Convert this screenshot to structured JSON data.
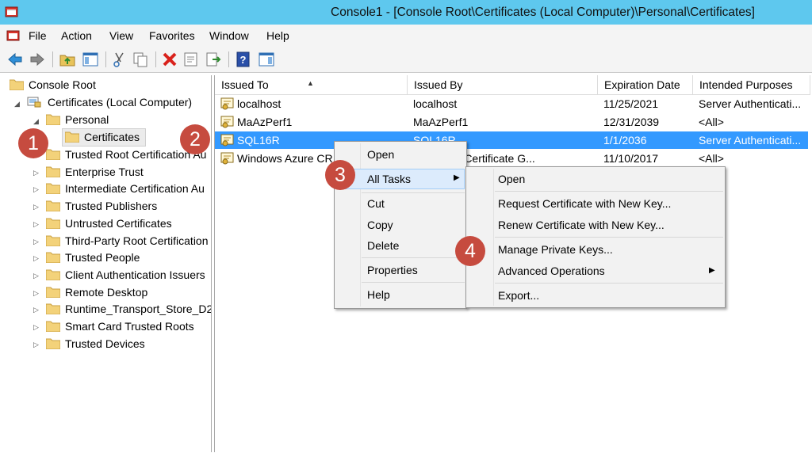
{
  "window": {
    "title": "Console1 - [Console Root\\Certificates (Local Computer)\\Personal\\Certificates]"
  },
  "menubar": {
    "items": [
      "File",
      "Action",
      "View",
      "Favorites",
      "Window",
      "Help"
    ]
  },
  "toolbar": {
    "buttons": [
      "back-arrow-icon",
      "forward-arrow-icon",
      "up-folder-icon",
      "show-hide-tree-icon",
      "cut-icon",
      "copy-icon",
      "delete-icon",
      "properties-icon",
      "export-list-icon",
      "help-icon",
      "show-action-pane-icon"
    ]
  },
  "tree": {
    "root": "Console Root",
    "computer": "Certificates (Local Computer)",
    "personal": "Personal",
    "certificates": "Certificates",
    "items": [
      "Trusted Root Certification Au",
      "Enterprise Trust",
      "Intermediate Certification Au",
      "Trusted Publishers",
      "Untrusted Certificates",
      "Third-Party Root Certification",
      "Trusted People",
      "Client Authentication Issuers",
      "Remote Desktop",
      "Runtime_Transport_Store_D2",
      "Smart Card Trusted Roots",
      "Trusted Devices"
    ]
  },
  "list": {
    "columns": [
      "Issued To",
      "Issued By",
      "Expiration Date",
      "Intended Purposes"
    ],
    "rows": [
      [
        "localhost",
        "localhost",
        "11/25/2021",
        "Server Authenticati..."
      ],
      [
        "MaAzPerf1",
        "MaAzPerf1",
        "12/31/2039",
        "<All>"
      ],
      [
        "SQL16R",
        "SQL16R",
        "1/1/2036",
        "Server Authenticati..."
      ],
      [
        "Windows Azure CR",
        "zure CRP Certificate G...",
        "11/10/2017",
        "<All>"
      ]
    ],
    "selected_row": 2
  },
  "context_menu": {
    "open": "Open",
    "all_tasks": "All Tasks",
    "cut": "Cut",
    "copy": "Copy",
    "delete": "Delete",
    "properties": "Properties",
    "help": "Help"
  },
  "submenu": {
    "open": "Open",
    "request": "Request Certificate with New Key...",
    "renew": "Renew Certificate with New Key...",
    "manage_keys": "Manage Private Keys...",
    "advanced": "Advanced Operations",
    "export": "Export..."
  },
  "badges": [
    "1",
    "2",
    "3",
    "4"
  ],
  "colors": {
    "titlebar": "#5ec8ee",
    "selection": "#3399ff",
    "badge": "#c64b3f",
    "menu_highlight": "#dcebfc"
  }
}
